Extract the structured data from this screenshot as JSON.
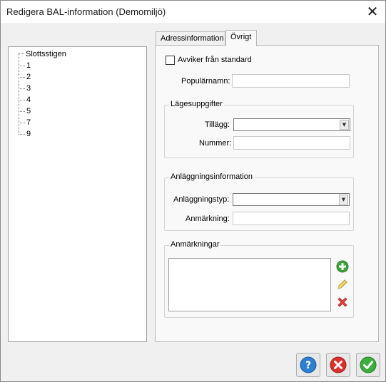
{
  "window": {
    "title": "Redigera BAL-information (Demomiljö)",
    "close_glyph": "✕"
  },
  "tree": {
    "root": "Slottsstigen",
    "items": [
      "1",
      "2",
      "3",
      "4",
      "5",
      "7",
      "9"
    ]
  },
  "tabs": [
    "Adressinformation",
    "Övrigt"
  ],
  "active_tab": "Övrigt",
  "form": {
    "avviker_label": "Avviker från standard",
    "avviker_checked": false,
    "popularnamn_label": "Populärnamn:",
    "popularnamn_value": "",
    "lage": {
      "title": "Lägesuppgifter",
      "tillagg_label": "Tillägg:",
      "tillagg_value": "",
      "nummer_label": "Nummer:",
      "nummer_value": ""
    },
    "anlaggning": {
      "title": "Anläggningsinformation",
      "typ_label": "Anläggningstyp:",
      "typ_value": "",
      "anmarkning_label": "Anmärkning:",
      "anmarkning_value": ""
    },
    "anmarkningar": {
      "title": "Anmärkningar",
      "items": [],
      "icons": [
        "add-icon",
        "edit-pencil-icon",
        "delete-icon"
      ]
    }
  },
  "buttons": {
    "icons": [
      "help-icon",
      "cancel-icon",
      "ok-icon"
    ]
  },
  "colors": {
    "help": "#2f7fd1",
    "cancel": "#d9302c",
    "ok": "#3cae3c",
    "add": "#3aa53a",
    "delete": "#e04040"
  }
}
